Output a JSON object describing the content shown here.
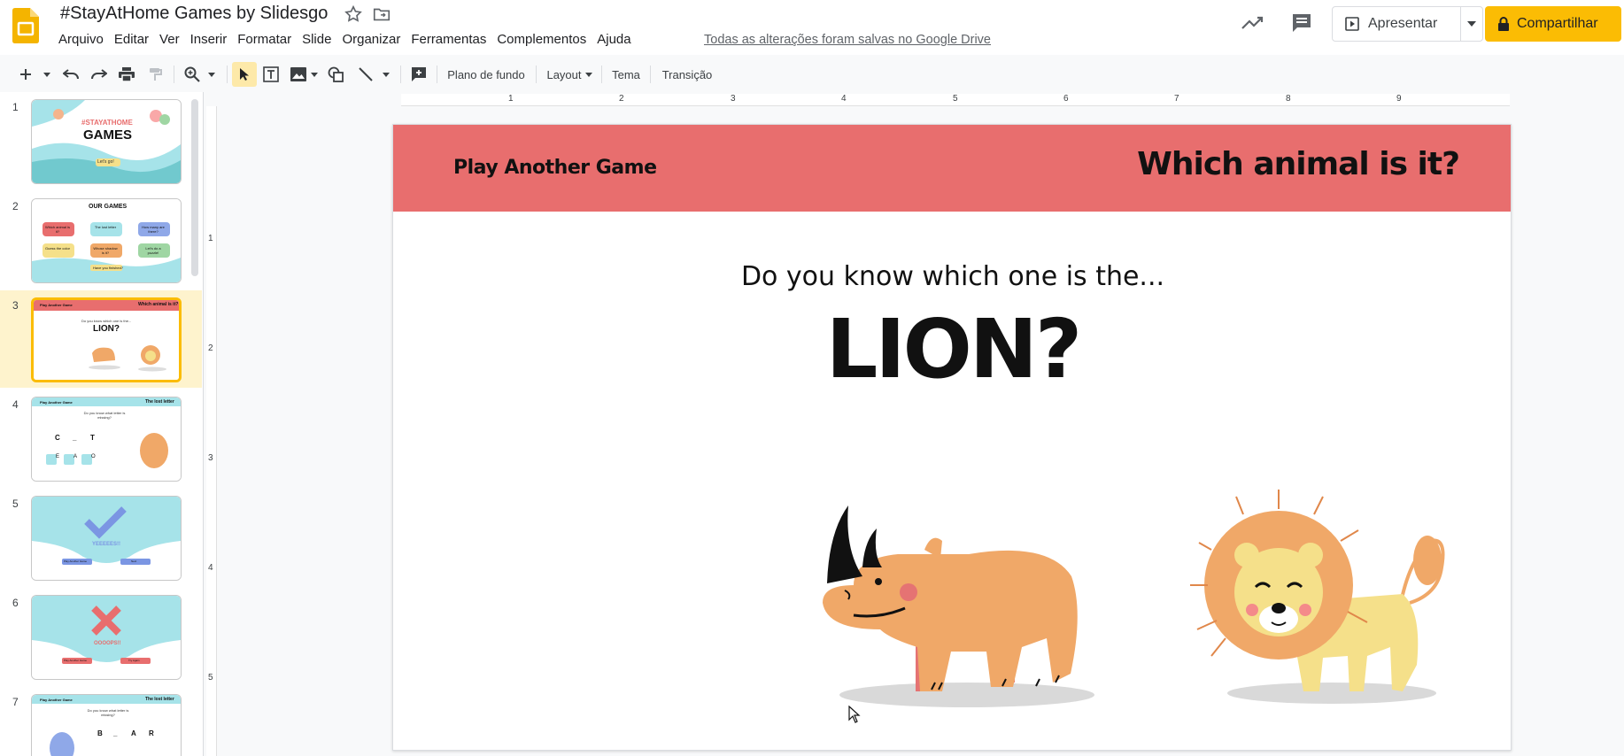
{
  "header": {
    "title": "#StayAtHome Games by Slidesgo",
    "menu": [
      "Arquivo",
      "Editar",
      "Ver",
      "Inserir",
      "Formatar",
      "Slide",
      "Organizar",
      "Ferramentas",
      "Complementos",
      "Ajuda"
    ],
    "saved_status": "Todas as alterações foram salvas no Google Drive",
    "present_label": "Apresentar",
    "share_label": "Compartilhar"
  },
  "toolbar": {
    "background_label": "Plano de fundo",
    "layout_label": "Layout",
    "theme_label": "Tema",
    "transition_label": "Transição"
  },
  "ruler": {
    "top_ticks": [
      "1",
      "2",
      "3",
      "4",
      "5",
      "6",
      "7",
      "8",
      "9"
    ],
    "left_ticks": [
      "1",
      "2",
      "3",
      "4",
      "5"
    ]
  },
  "filmstrip": {
    "slides": [
      {
        "number": "1",
        "caption": "#STAYATHOME",
        "caption2": "GAMES",
        "button": "Let's go!"
      },
      {
        "number": "2",
        "caption": "OUR GAMES",
        "cards": [
          "Which animal is it?",
          "The lost letter",
          "How many are there?",
          "Guess the color",
          "Whose shadow is it?",
          "Let's do a puzzle!"
        ],
        "button": "Have you finished?"
      },
      {
        "number": "3",
        "caption": "Which animal is it?",
        "small": "Play Another Game",
        "q": "Do you know which one is the...",
        "big": "LION?"
      },
      {
        "number": "4",
        "caption": "The lost letter",
        "small": "Play Another Game",
        "q": "Do you know what letter is missing?",
        "letters": [
          "C",
          "_",
          "T"
        ],
        "options": [
          "E",
          "A",
          "O"
        ]
      },
      {
        "number": "5",
        "caption": "YEEEEES!!",
        "buttons": [
          "Play Another Game",
          "Next"
        ]
      },
      {
        "number": "6",
        "caption": "OOOOPS!!",
        "buttons": [
          "Play Another Game",
          "Try Again"
        ]
      },
      {
        "number": "7",
        "caption": "The lost letter",
        "small": "Play Another Game",
        "q": "Do you know what letter is missing?",
        "letters": [
          "B",
          "_",
          "A",
          "R"
        ]
      }
    ]
  },
  "slide": {
    "banner_left": "Play Another Game",
    "banner_right": "Which animal is it?",
    "question": "Do you know which one is the...",
    "answer": "LION?"
  },
  "colors": {
    "banner": "#e86e6e",
    "share": "#fbbc04",
    "selected_thumb": "#fef3cd",
    "rhino": "#f0a868",
    "lion_mane": "#f0a868",
    "lion_body": "#f5e08a"
  }
}
